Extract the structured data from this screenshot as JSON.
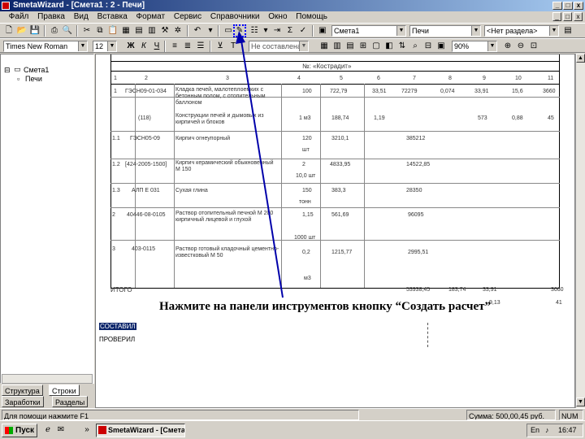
{
  "window": {
    "title": "SmetaWizard - [Смета1 : 2 - Печи]",
    "min": "_",
    "max": "□",
    "close": "x"
  },
  "menu": [
    "Файл",
    "Правка",
    "Вид",
    "Вставка",
    "Формат",
    "Сервис",
    "Справочники",
    "Окно",
    "Помощь"
  ],
  "toolbar1": {
    "estimate_combo": "Смета1",
    "section_combo": "Печи",
    "subsection_combo": "<Нет раздела>"
  },
  "toolbar2": {
    "font_combo": "Times New Roman",
    "size_combo": "12",
    "bold": "Ж",
    "italic": "К",
    "underline": "Ч",
    "style_combo": "Не составлена ре",
    "zoom_combo": "90%"
  },
  "tree": {
    "root": "Смета1",
    "child": "Печи"
  },
  "tabs": {
    "structure": "Структура",
    "lines": "Строки",
    "works": "Заработки",
    "sections": "Разделы"
  },
  "document": {
    "section_header": "№: «Кострадит»",
    "col_numbers": [
      "1",
      "2",
      "3",
      "4",
      "5",
      "6",
      "7",
      "8",
      "9",
      "10",
      "11"
    ],
    "rows": [
      {
        "n": "1",
        "code": "ГЭСН09-01-034",
        "name": "Кладка печей, малотеплоемких с бетонным полом, с отопительным баллоном",
        "qty": "100",
        "price": "722,79",
        "c6": "33,51",
        "c7": "72279",
        "c8": "0,074",
        "c9": "33,91",
        "c10": "15,6",
        "c11": "3660"
      },
      {
        "n": "",
        "code": "(118)",
        "name": "Конструкции печей и дымовых из кирпичей и блоков",
        "qty": "1 м3",
        "price": "188,74",
        "c6": "1,19",
        "c7": "",
        "c8": "",
        "c9": "573",
        "c10": "0,88",
        "c11": "45"
      },
      {
        "n": "1.1",
        "code": "ГЭСН05-09",
        "name": "Кирпич огнеупорный",
        "qty": "120",
        "price": "3210,1",
        "c6": "",
        "c7": "385212",
        "c8": "",
        "c9": "",
        "c10": "",
        "c11": ""
      },
      {
        "n": "1.2",
        "code": "[424-2005-1500]",
        "name": "Кирпич керамический обыкновенный М 150",
        "qty": "2",
        "price": "4833,95",
        "c6": "",
        "c7": "14522,85",
        "c8": "",
        "c9": "",
        "c10": "",
        "c11": ""
      },
      {
        "n": "1.3",
        "code": "АЛП Е 031",
        "name": "Сухая глина",
        "qty": "150",
        "price": "383,3",
        "c6": "",
        "c7": "28350",
        "c8": "",
        "c9": "",
        "c10": "",
        "c11": ""
      },
      {
        "n": "2",
        "code": "40446-08-0105",
        "name": "Раствор отопительный печной М 200 кирпичный лицевой и глухой",
        "qty": "1,15",
        "price": "561,69",
        "c6": "",
        "c7": "96095",
        "c8": "",
        "c9": "",
        "c10": "",
        "c11": ""
      },
      {
        "n": "3",
        "code": "403-0115",
        "name": "Раствор готовый кладочный цементно-известковый М 50",
        "qty": "0,2",
        "price": "1215,77",
        "c6": "",
        "c7": "2995,51",
        "c8": "",
        "c9": "",
        "c10": "",
        "c11": ""
      }
    ],
    "units": [
      "шт",
      "10,0 шт",
      "тонн",
      "1000 шт",
      "м3"
    ],
    "total_label": "ИТОГО",
    "total_values": [
      "53938,45",
      "183,74",
      "33,91",
      "3660"
    ],
    "total_sub": "9,13",
    "total_sub2": "41",
    "footer_1": "СОСТАВИЛ",
    "footer_2": "ПРОВЕРИЛ"
  },
  "instruction": "Нажмите на панели инструментов кнопку “Создать расчет”",
  "status": {
    "hint": "Для помощи нажмите F1",
    "totals": "Сумма: 500,00,45 руб.",
    "num": "NUM"
  },
  "taskbar": {
    "start": "Пуск",
    "task": "SmetaWizard - [Смета1...",
    "clock": "16:47"
  },
  "colors": {
    "titlebar": "#0a246a",
    "arrow": "#0000aa"
  }
}
